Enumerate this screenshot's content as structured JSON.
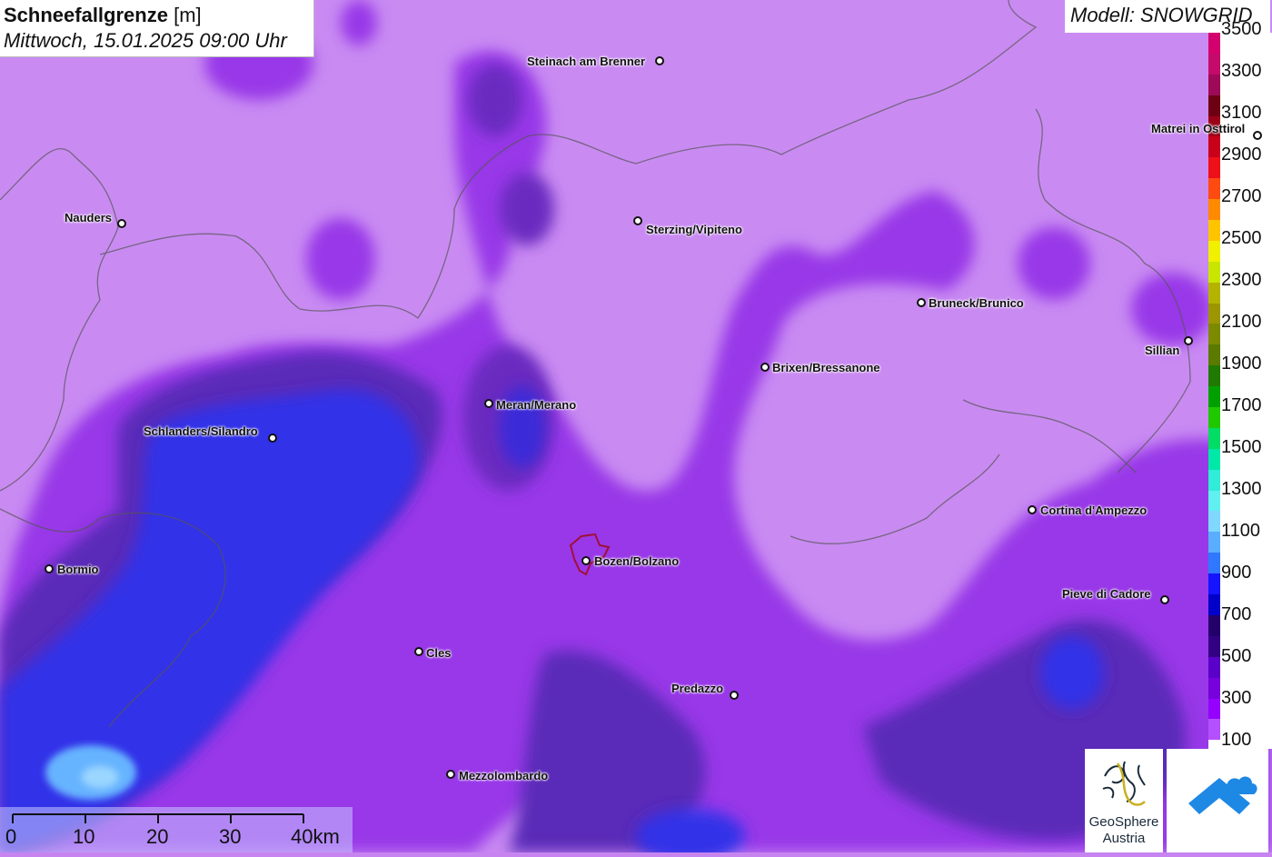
{
  "header": {
    "title_bold": "Schneefallgrenze",
    "title_unit": "[m]",
    "datetime": "Mittwoch, 15.01.2025 09:00 Uhr",
    "model": "Modell: SNOWGRID"
  },
  "legend": {
    "labels": [
      "3500",
      "3300",
      "3100",
      "2900",
      "2700",
      "2500",
      "2300",
      "2100",
      "1900",
      "1700",
      "1500",
      "1300",
      "1100",
      "900",
      "700",
      "500",
      "300",
      "100"
    ],
    "colors": [
      "#d4006e",
      "#c40a6a",
      "#9e0a58",
      "#6e0014",
      "#9a0016",
      "#c8001a",
      "#ee1018",
      "#ff4b12",
      "#ff8a00",
      "#ffc400",
      "#f0f000",
      "#c8e600",
      "#b4b400",
      "#9c9600",
      "#7c8a00",
      "#5a7a00",
      "#207a00",
      "#00a000",
      "#20c800",
      "#00dc64",
      "#00e8a8",
      "#30ecd8",
      "#60f0f0",
      "#80d8ff",
      "#5aaeff",
      "#3078ff",
      "#1414ff",
      "#0000c8",
      "#24006a",
      "#320082",
      "#5a00c8",
      "#7800dc",
      "#9600ff",
      "#b450ff"
    ]
  },
  "cities": [
    {
      "name": "Steinach am Brenner",
      "id": "steinach"
    },
    {
      "name": "Nauders",
      "id": "nauders"
    },
    {
      "name": "Sterzing/Vipiteno",
      "id": "sterzing"
    },
    {
      "name": "Matrei in Osttirol",
      "id": "matrei"
    },
    {
      "name": "Bruneck/Brunico",
      "id": "bruneck"
    },
    {
      "name": "Sillian",
      "id": "sillian"
    },
    {
      "name": "Brixen/Bressanone",
      "id": "brixen"
    },
    {
      "name": "Meran/Merano",
      "id": "meran"
    },
    {
      "name": "Schlanders/Silandro",
      "id": "schlanders"
    },
    {
      "name": "Cortina d'Ampezzo",
      "id": "cortina"
    },
    {
      "name": "Bormio",
      "id": "bormio"
    },
    {
      "name": "Bozen/Bolzano",
      "id": "bozen"
    },
    {
      "name": "Pieve di Cadore",
      "id": "pieve"
    },
    {
      "name": "Cles",
      "id": "cles"
    },
    {
      "name": "Predazzo",
      "id": "predazzo"
    },
    {
      "name": "Mezzolombardo",
      "id": "mezzolombardo"
    }
  ],
  "scale": {
    "labels": [
      "0",
      "10",
      "20",
      "30",
      "40km"
    ]
  },
  "logos": {
    "geosphere_line1": "GeoSphere",
    "geosphere_line2": "Austria"
  }
}
